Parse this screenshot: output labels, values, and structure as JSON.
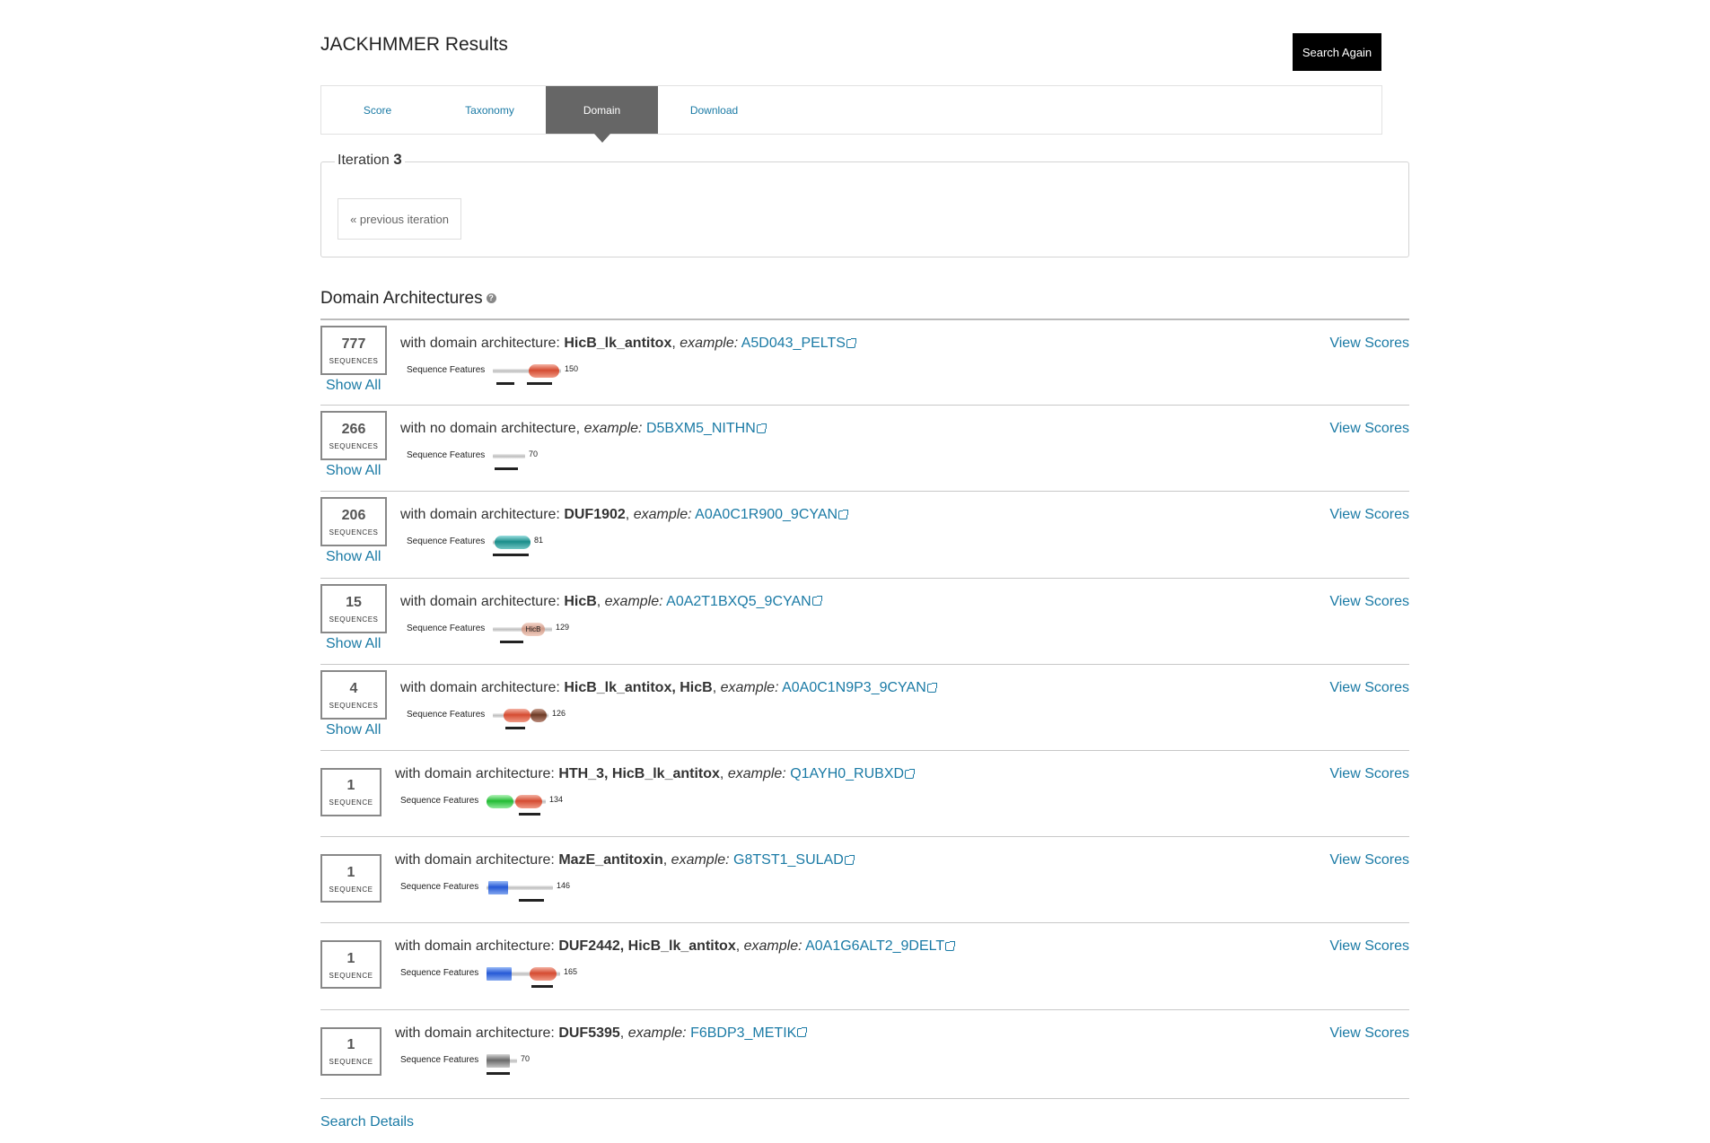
{
  "header": {
    "title": "JACKHMMER Results",
    "search_again": "Search Again"
  },
  "tabs": [
    {
      "label": "Score"
    },
    {
      "label": "Taxonomy"
    },
    {
      "label": "Domain"
    },
    {
      "label": "Download"
    }
  ],
  "iteration": {
    "label": "Iteration",
    "number": "3",
    "prev_button": "« previous iteration"
  },
  "section_title": "Domain Architectures",
  "features_label": "Sequence Features",
  "view_scores_label": "View Scores",
  "show_all_label": "Show All",
  "rows": [
    {
      "count": "777",
      "unit": "SEQUENCES",
      "prefix": "with domain architecture:",
      "arch": "HicB_lk_antitox",
      "example_label": "example:",
      "example": "A5D043_PELTS",
      "length": "150"
    },
    {
      "count": "266",
      "unit": "SEQUENCES",
      "prefix": "with no domain architecture,",
      "arch": "",
      "example_label": "example:",
      "example": "D5BXM5_NITHN",
      "length": "70"
    },
    {
      "count": "206",
      "unit": "SEQUENCES",
      "prefix": "with domain architecture:",
      "arch": "DUF1902",
      "example_label": "example:",
      "example": "A0A0C1R900_9CYAN",
      "length": "81"
    },
    {
      "count": "15",
      "unit": "SEQUENCES",
      "prefix": "with domain architecture:",
      "arch": "HicB",
      "example_label": "example:",
      "example": "A0A2T1BXQ5_9CYAN",
      "length": "129",
      "domain_text": "HicB"
    },
    {
      "count": "4",
      "unit": "SEQUENCES",
      "prefix": "with domain architecture:",
      "arch": "HicB_lk_antitox, HicB",
      "example_label": "example:",
      "example": "A0A0C1N9P3_9CYAN",
      "length": "126"
    },
    {
      "count": "1",
      "unit": "SEQUENCE",
      "prefix": "with domain architecture:",
      "arch": "HTH_3, HicB_lk_antitox",
      "example_label": "example:",
      "example": "Q1AYH0_RUBXD",
      "length": "134"
    },
    {
      "count": "1",
      "unit": "SEQUENCE",
      "prefix": "with domain architecture:",
      "arch": "MazE_antitoxin",
      "example_label": "example:",
      "example": "G8TST1_SULAD",
      "length": "146"
    },
    {
      "count": "1",
      "unit": "SEQUENCE",
      "prefix": "with domain architecture:",
      "arch": "DUF2442, HicB_lk_antitox",
      "example_label": "example:",
      "example": "A0A1G6ALT2_9DELT",
      "length": "165"
    },
    {
      "count": "1",
      "unit": "SEQUENCE",
      "prefix": "with domain architecture:",
      "arch": "DUF5395",
      "example_label": "example:",
      "example": "F6BDP3_METIK",
      "length": "70"
    }
  ],
  "footer": {
    "search_details": "Search Details"
  },
  "colors": {
    "link": "#1a7aa5",
    "active_tab": "#666666"
  }
}
